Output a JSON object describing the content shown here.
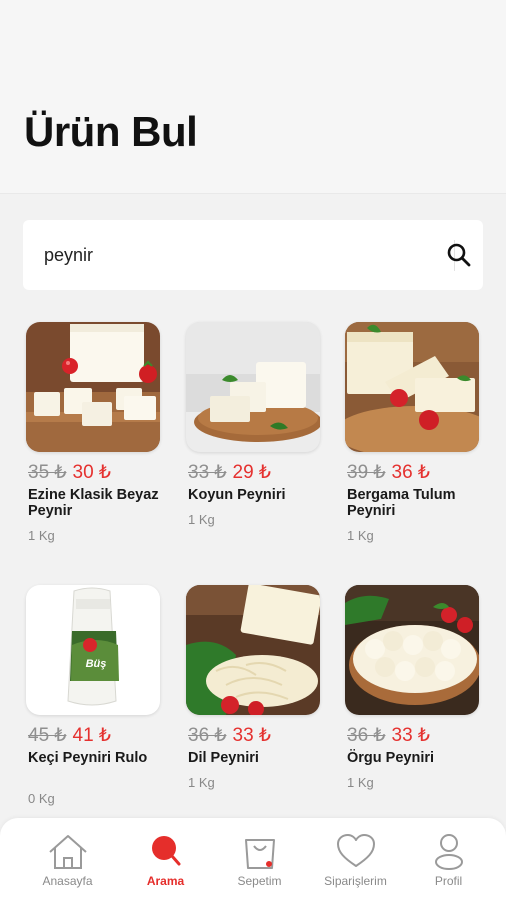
{
  "header": {
    "title": "Ürün Bul"
  },
  "search": {
    "value": "peynir"
  },
  "currency": "₺",
  "products": [
    {
      "name": "Ezine Klasik Beyaz Peynir",
      "old_price": "35 ₺",
      "price": "30 ₺",
      "weight": "1 Kg"
    },
    {
      "name": "Koyun Peyniri",
      "old_price": "33 ₺",
      "price": "29 ₺",
      "weight": "1 Kg"
    },
    {
      "name": "Bergama Tulum Peyniri",
      "old_price": "39 ₺",
      "price": "36 ₺",
      "weight": "1 Kg"
    },
    {
      "name": "Keçi Peyniri Rulo",
      "old_price": "45 ₺",
      "price": "41 ₺",
      "weight": "0 Kg"
    },
    {
      "name": "Dil Peyniri",
      "old_price": "36 ₺",
      "price": "33 ₺",
      "weight": "1 Kg"
    },
    {
      "name": "Örgu Peyniri",
      "old_price": "36 ₺",
      "price": "33 ₺",
      "weight": "1 Kg"
    }
  ],
  "product_images": {
    "keci_label": "Büş"
  },
  "nav": [
    {
      "label": "Anasayfa",
      "icon": "home-icon"
    },
    {
      "label": "Arama",
      "icon": "search-icon",
      "active": true
    },
    {
      "label": "Sepetim",
      "icon": "shopping-bag-icon"
    },
    {
      "label": "Siparişlerim",
      "icon": "heart-icon"
    },
    {
      "label": "Profil",
      "icon": "user-icon"
    }
  ],
  "colors": {
    "accent": "#e5312f",
    "old_price": "#8f8f8f",
    "background": "#f2f2f2"
  }
}
